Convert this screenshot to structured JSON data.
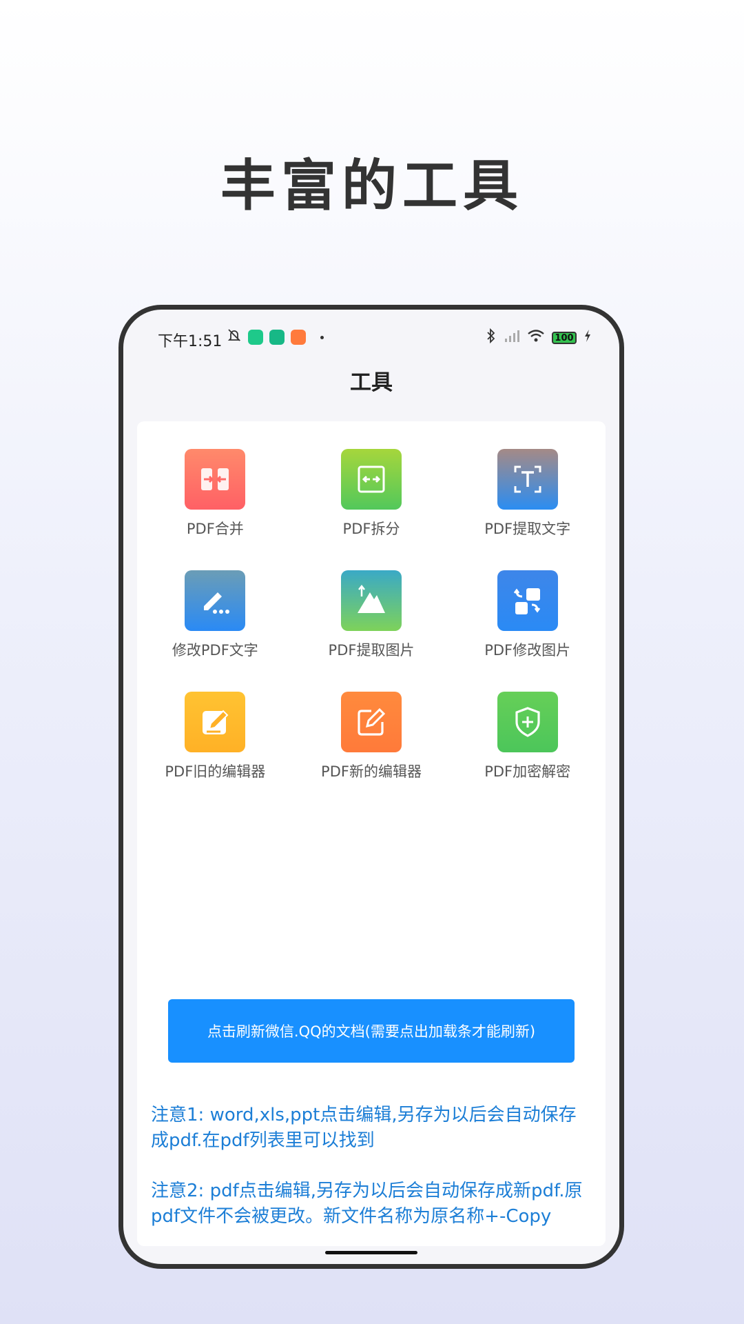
{
  "headline": "丰富的工具",
  "status_bar": {
    "time": "下午1:51",
    "battery": "100",
    "left_icons": [
      "alarm-off-icon",
      "app-shield-icon",
      "app-shield-icon",
      "app-cat-icon",
      "dot-icon"
    ],
    "right_icons": [
      "bluetooth-icon",
      "signal-icon",
      "wifi-icon",
      "battery-icon",
      "charging-icon"
    ]
  },
  "page_title": "工具",
  "tools": [
    {
      "label": "PDF合并",
      "icon": "merge-icon",
      "gradient": [
        "#ff8a6b",
        "#ff6065"
      ]
    },
    {
      "label": "PDF拆分",
      "icon": "split-icon",
      "gradient": [
        "#a6d63c",
        "#52c85b"
      ]
    },
    {
      "label": "PDF提取文字",
      "icon": "text-scan-icon",
      "gradient": [
        "#a58a86",
        "#2b8df2"
      ]
    },
    {
      "label": "修改PDF文字",
      "icon": "edit-text-icon",
      "gradient": [
        "#6b9db6",
        "#2a8af5"
      ]
    },
    {
      "label": "PDF提取图片",
      "icon": "image-extract-icon",
      "gradient": [
        "#3aa9c6",
        "#7ed25a"
      ]
    },
    {
      "label": "PDF修改图片",
      "icon": "image-edit-icon",
      "gradient": [
        "#3e86e9",
        "#2a8af5"
      ]
    },
    {
      "label": "PDF旧的编辑器",
      "icon": "editor-old-icon",
      "gradient": [
        "#ffc332",
        "#ffb126"
      ]
    },
    {
      "label": "PDF新的编辑器",
      "icon": "editor-new-icon",
      "gradient": [
        "#ff8a3d",
        "#ff7a3a"
      ]
    },
    {
      "label": "PDF加密解密",
      "icon": "shield-plus-icon",
      "gradient": [
        "#66cf58",
        "#4cc65a"
      ]
    }
  ],
  "refresh_button": "点击刷新微信.QQ的文档(需要点出加载条才能刷新)",
  "note1": "注意1: word,xls,ppt点击编辑,另存为以后会自动保存成pdf.在pdf列表里可以找到",
  "note2": "注意2: pdf点击编辑,另存为以后会自动保存成新pdf.原pdf文件不会被更改。新文件名称为原名称+-Copy",
  "colors": {
    "accent": "#1890ff",
    "note_text": "#1c7ed6"
  }
}
